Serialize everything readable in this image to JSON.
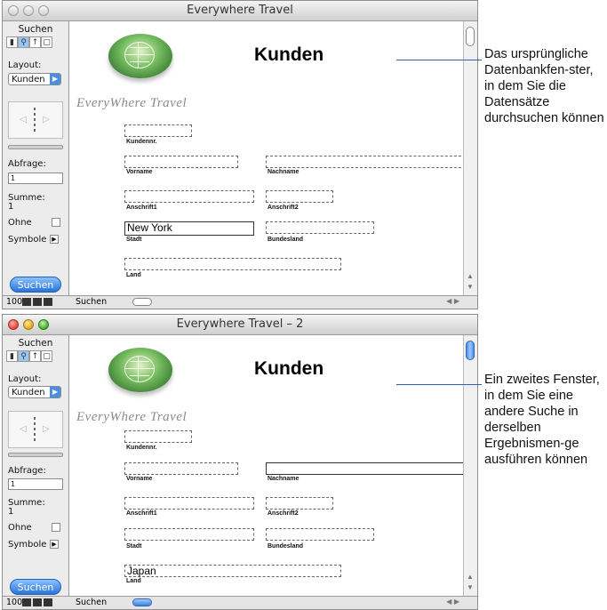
{
  "windows": [
    {
      "id": "w1",
      "title": "Everywhere Travel",
      "active": false,
      "sidebar": {
        "mode_title": "Suchen",
        "layout_label": "Layout:",
        "layout_value": "Kunden",
        "query_label": "Abfrage:",
        "query_value": "1",
        "sum_label": "Summe:",
        "sum_value": "1",
        "omit_label": "Ohne",
        "symbols_label": "Symbole",
        "find_button": "Suchen"
      },
      "form": {
        "brand": "EveryWhere Travel",
        "heading": "Kunden",
        "fields": {
          "kundennr": {
            "label": "Kundennr.",
            "value": ""
          },
          "vorname": {
            "label": "Vorname",
            "value": ""
          },
          "nachname": {
            "label": "Nachname",
            "value": ""
          },
          "anschrift1": {
            "label": "Anschrift1",
            "value": ""
          },
          "anschrift2": {
            "label": "Anschrift2",
            "value": ""
          },
          "stadt": {
            "label": "Stadt",
            "value": "New York"
          },
          "bundesland": {
            "label": "Bundesland",
            "value": ""
          },
          "land": {
            "label": "Land",
            "value": ""
          }
        }
      },
      "status": {
        "zoom": "100",
        "mode": "Suchen"
      }
    },
    {
      "id": "w2",
      "title": "Everywhere Travel – 2",
      "active": true,
      "sidebar": {
        "mode_title": "Suchen",
        "layout_label": "Layout:",
        "layout_value": "Kunden",
        "query_label": "Abfrage:",
        "query_value": "1",
        "sum_label": "Summe:",
        "sum_value": "1",
        "omit_label": "Ohne",
        "symbols_label": "Symbole",
        "find_button": "Suchen"
      },
      "form": {
        "brand": "EveryWhere Travel",
        "heading": "Kunden",
        "fields": {
          "kundennr": {
            "label": "Kundennr.",
            "value": ""
          },
          "vorname": {
            "label": "Vorname",
            "value": ""
          },
          "nachname": {
            "label": "Nachname",
            "value": ""
          },
          "anschrift1": {
            "label": "Anschrift1",
            "value": ""
          },
          "anschrift2": {
            "label": "Anschrift2",
            "value": ""
          },
          "stadt": {
            "label": "Stadt",
            "value": ""
          },
          "bundesland": {
            "label": "Bundesland",
            "value": ""
          },
          "land": {
            "label": "Land",
            "value": "Japan"
          }
        }
      },
      "status": {
        "zoom": "100",
        "mode": "Suchen"
      }
    }
  ],
  "annotations": {
    "first": "Das ursprüngliche Datenbankfen-ster, in dem Sie die Datensätze durchsuchen können",
    "second": "Ein zweites Fenster, in dem Sie eine andere Suche in derselben Ergebnismen-ge ausführen können"
  },
  "colors": {
    "annotation_line": "#2f5fb7",
    "accent_blue": "#2a73d8"
  }
}
